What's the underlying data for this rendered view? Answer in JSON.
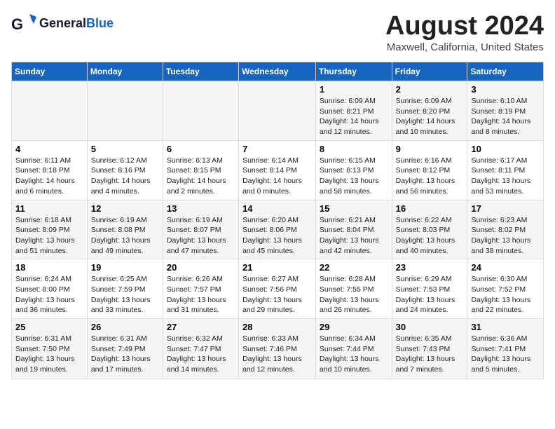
{
  "header": {
    "logo_general": "General",
    "logo_blue": "Blue",
    "main_title": "August 2024",
    "subtitle": "Maxwell, California, United States"
  },
  "calendar": {
    "weekdays": [
      "Sunday",
      "Monday",
      "Tuesday",
      "Wednesday",
      "Thursday",
      "Friday",
      "Saturday"
    ],
    "weeks": [
      [
        {
          "day": "",
          "info": ""
        },
        {
          "day": "",
          "info": ""
        },
        {
          "day": "",
          "info": ""
        },
        {
          "day": "",
          "info": ""
        },
        {
          "day": "1",
          "info": "Sunrise: 6:09 AM\nSunset: 8:21 PM\nDaylight: 14 hours\nand 12 minutes."
        },
        {
          "day": "2",
          "info": "Sunrise: 6:09 AM\nSunset: 8:20 PM\nDaylight: 14 hours\nand 10 minutes."
        },
        {
          "day": "3",
          "info": "Sunrise: 6:10 AM\nSunset: 8:19 PM\nDaylight: 14 hours\nand 8 minutes."
        }
      ],
      [
        {
          "day": "4",
          "info": "Sunrise: 6:11 AM\nSunset: 8:18 PM\nDaylight: 14 hours\nand 6 minutes."
        },
        {
          "day": "5",
          "info": "Sunrise: 6:12 AM\nSunset: 8:16 PM\nDaylight: 14 hours\nand 4 minutes."
        },
        {
          "day": "6",
          "info": "Sunrise: 6:13 AM\nSunset: 8:15 PM\nDaylight: 14 hours\nand 2 minutes."
        },
        {
          "day": "7",
          "info": "Sunrise: 6:14 AM\nSunset: 8:14 PM\nDaylight: 14 hours\nand 0 minutes."
        },
        {
          "day": "8",
          "info": "Sunrise: 6:15 AM\nSunset: 8:13 PM\nDaylight: 13 hours\nand 58 minutes."
        },
        {
          "day": "9",
          "info": "Sunrise: 6:16 AM\nSunset: 8:12 PM\nDaylight: 13 hours\nand 56 minutes."
        },
        {
          "day": "10",
          "info": "Sunrise: 6:17 AM\nSunset: 8:11 PM\nDaylight: 13 hours\nand 53 minutes."
        }
      ],
      [
        {
          "day": "11",
          "info": "Sunrise: 6:18 AM\nSunset: 8:09 PM\nDaylight: 13 hours\nand 51 minutes."
        },
        {
          "day": "12",
          "info": "Sunrise: 6:19 AM\nSunset: 8:08 PM\nDaylight: 13 hours\nand 49 minutes."
        },
        {
          "day": "13",
          "info": "Sunrise: 6:19 AM\nSunset: 8:07 PM\nDaylight: 13 hours\nand 47 minutes."
        },
        {
          "day": "14",
          "info": "Sunrise: 6:20 AM\nSunset: 8:06 PM\nDaylight: 13 hours\nand 45 minutes."
        },
        {
          "day": "15",
          "info": "Sunrise: 6:21 AM\nSunset: 8:04 PM\nDaylight: 13 hours\nand 42 minutes."
        },
        {
          "day": "16",
          "info": "Sunrise: 6:22 AM\nSunset: 8:03 PM\nDaylight: 13 hours\nand 40 minutes."
        },
        {
          "day": "17",
          "info": "Sunrise: 6:23 AM\nSunset: 8:02 PM\nDaylight: 13 hours\nand 38 minutes."
        }
      ],
      [
        {
          "day": "18",
          "info": "Sunrise: 6:24 AM\nSunset: 8:00 PM\nDaylight: 13 hours\nand 36 minutes."
        },
        {
          "day": "19",
          "info": "Sunrise: 6:25 AM\nSunset: 7:59 PM\nDaylight: 13 hours\nand 33 minutes."
        },
        {
          "day": "20",
          "info": "Sunrise: 6:26 AM\nSunset: 7:57 PM\nDaylight: 13 hours\nand 31 minutes."
        },
        {
          "day": "21",
          "info": "Sunrise: 6:27 AM\nSunset: 7:56 PM\nDaylight: 13 hours\nand 29 minutes."
        },
        {
          "day": "22",
          "info": "Sunrise: 6:28 AM\nSunset: 7:55 PM\nDaylight: 13 hours\nand 26 minutes."
        },
        {
          "day": "23",
          "info": "Sunrise: 6:29 AM\nSunset: 7:53 PM\nDaylight: 13 hours\nand 24 minutes."
        },
        {
          "day": "24",
          "info": "Sunrise: 6:30 AM\nSunset: 7:52 PM\nDaylight: 13 hours\nand 22 minutes."
        }
      ],
      [
        {
          "day": "25",
          "info": "Sunrise: 6:31 AM\nSunset: 7:50 PM\nDaylight: 13 hours\nand 19 minutes."
        },
        {
          "day": "26",
          "info": "Sunrise: 6:31 AM\nSunset: 7:49 PM\nDaylight: 13 hours\nand 17 minutes."
        },
        {
          "day": "27",
          "info": "Sunrise: 6:32 AM\nSunset: 7:47 PM\nDaylight: 13 hours\nand 14 minutes."
        },
        {
          "day": "28",
          "info": "Sunrise: 6:33 AM\nSunset: 7:46 PM\nDaylight: 13 hours\nand 12 minutes."
        },
        {
          "day": "29",
          "info": "Sunrise: 6:34 AM\nSunset: 7:44 PM\nDaylight: 13 hours\nand 10 minutes."
        },
        {
          "day": "30",
          "info": "Sunrise: 6:35 AM\nSunset: 7:43 PM\nDaylight: 13 hours\nand 7 minutes."
        },
        {
          "day": "31",
          "info": "Sunrise: 6:36 AM\nSunset: 7:41 PM\nDaylight: 13 hours\nand 5 minutes."
        }
      ]
    ]
  }
}
